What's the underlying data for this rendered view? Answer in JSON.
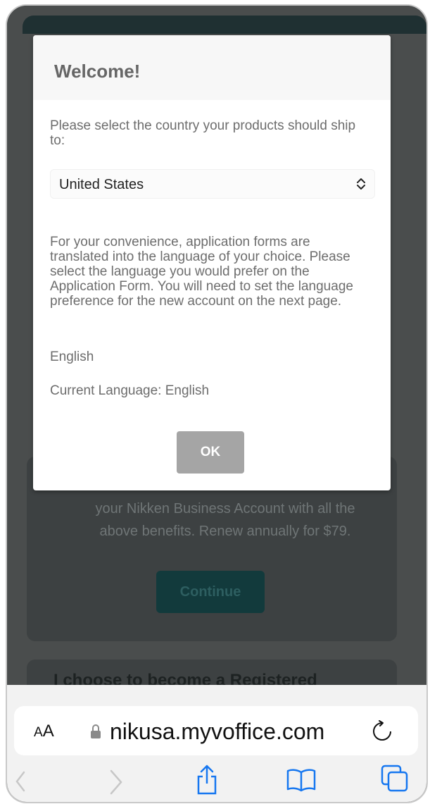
{
  "background_page": {
    "card_text": "your Nikken Business Account with all the above benefits. Renew annually for $79.",
    "continue_label": "Continue",
    "second_card_title": "I choose to become a Registered"
  },
  "modal": {
    "title": "Welcome!",
    "country_prompt": "Please select the country your products should ship to:",
    "country_select": {
      "selected": "United States"
    },
    "info_text": "For your convenience, application forms are translated into the language of your choice. Please select the language you would prefer on the Application Form. You will need to set the language preference for the new account on the next page.",
    "language": "English",
    "current_language": "Current Language: English",
    "ok_label": "OK"
  },
  "browser": {
    "text_size_label_small": "A",
    "text_size_label_large": "A",
    "url": "nikusa.myvoffice.com",
    "icons": [
      "lock-icon",
      "reload-icon",
      "back-icon",
      "forward-icon",
      "share-icon",
      "bookmarks-icon",
      "tabs-icon"
    ]
  }
}
